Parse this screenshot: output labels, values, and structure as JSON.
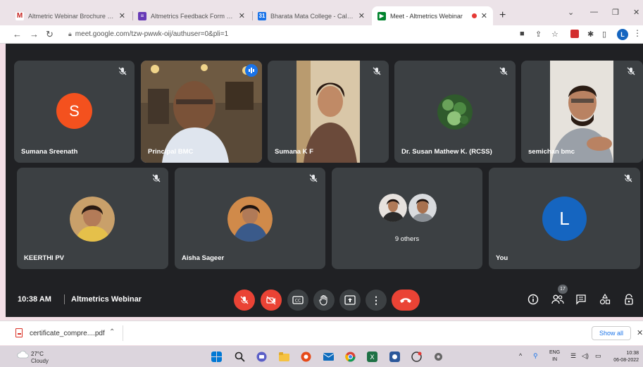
{
  "browser": {
    "tabs": [
      {
        "title": "Altmetric Webinar Brochure - Ilr",
        "favicon": "gmail-icon",
        "color": "#c5221f"
      },
      {
        "title": "Altmetrics Feedback Form - Goo",
        "favicon": "forms-icon",
        "color": "#673ab7"
      },
      {
        "title": "Bharata Mata College - Calend",
        "favicon": "calendar-icon",
        "color": "#1a73e8"
      },
      {
        "title": "Meet - Altmetrics Webinar",
        "favicon": "meet-icon",
        "color": "#00832d"
      }
    ],
    "url": "meet.google.com/tzw-pwwk-oij/authuser=0&pli=1",
    "profile_initial": "L"
  },
  "meet": {
    "top_row": [
      {
        "name": "Sumana Sreenath",
        "initial": "S",
        "avatar_color": "#f4511e",
        "kind": "initial",
        "muted": true
      },
      {
        "name": "Principal BMC",
        "kind": "video",
        "speaking": true,
        "muted": false
      },
      {
        "name": "Sumana K F",
        "kind": "video",
        "muted": true
      },
      {
        "name": "Dr. Susan Mathew K. (RCSS)",
        "kind": "photo",
        "muted": true
      },
      {
        "name": "semichan bmc",
        "kind": "video",
        "muted": true
      }
    ],
    "bottom_row": [
      {
        "name": "KEERTHI PV",
        "kind": "photo",
        "muted": true
      },
      {
        "name": "Aisha Sageer",
        "kind": "photo",
        "muted": true
      },
      {
        "name": "9 others",
        "kind": "group",
        "muted": false
      },
      {
        "name": "You",
        "initial": "L",
        "avatar_color": "#1565c0",
        "kind": "initial",
        "muted": true
      }
    ],
    "bottom_bar": {
      "time": "10:38 AM",
      "title": "Altmetrics Webinar",
      "participant_count": "17"
    }
  },
  "download": {
    "filename": "certificate_compre....pdf",
    "show_all": "Show all"
  },
  "taskbar": {
    "weather_temp": "27°C",
    "weather_desc": "Cloudy",
    "lang_line1": "ENG",
    "lang_line2": "IN",
    "time": "10:38",
    "date": "06-08-2022"
  },
  "colors": {
    "meet_bg": "#202124",
    "tile_bg": "#3c4043",
    "end_call": "#ea4335",
    "accent_blue": "#1a73e8"
  }
}
